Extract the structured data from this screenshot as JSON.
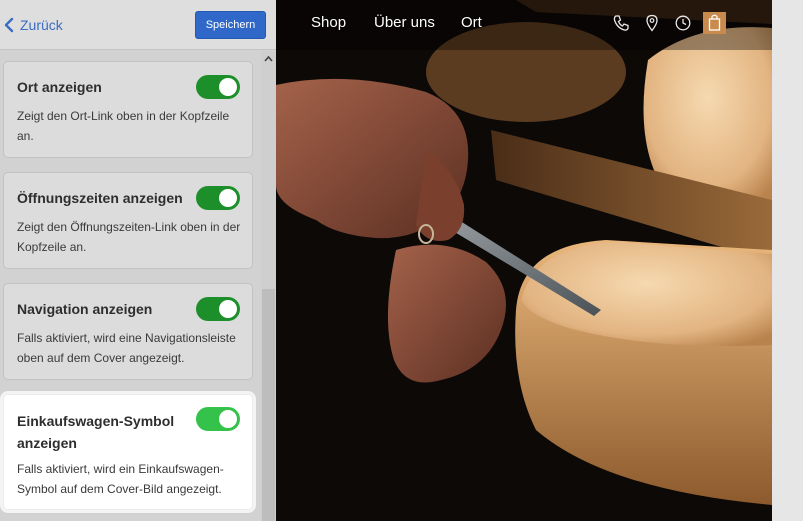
{
  "header": {
    "back_label": "Zurück",
    "save_label": "Speichern"
  },
  "settings": [
    {
      "title": "Ort anzeigen",
      "description": "Zeigt den Ort-Link oben in der Kopfzeile an.",
      "enabled": true
    },
    {
      "title": "Öffnungszeiten anzeigen",
      "description": "Zeigt den Öffnungszeiten-Link oben in der Kopfzeile an.",
      "enabled": true
    },
    {
      "title": "Navigation anzeigen",
      "description": "Falls aktiviert, wird eine Navigationsleiste oben auf dem Cover angezeigt.",
      "enabled": true
    },
    {
      "title": "Einkaufswagen-Symbol anzeigen",
      "description": "Falls aktiviert, wird ein Einkaufswagen-Symbol auf dem Cover-Bild angezeigt.",
      "enabled": true
    }
  ],
  "preview": {
    "nav": [
      "Shop",
      "Über uns",
      "Ort"
    ],
    "icons": [
      "phone-icon",
      "location-pin-icon",
      "clock-icon",
      "shopping-bag-icon"
    ]
  },
  "colors": {
    "accent": "#2f68c8",
    "toggle_on": "#1c8f2a",
    "toggle_on_active": "#34c24a",
    "cart_highlight": "#c98a4e"
  }
}
